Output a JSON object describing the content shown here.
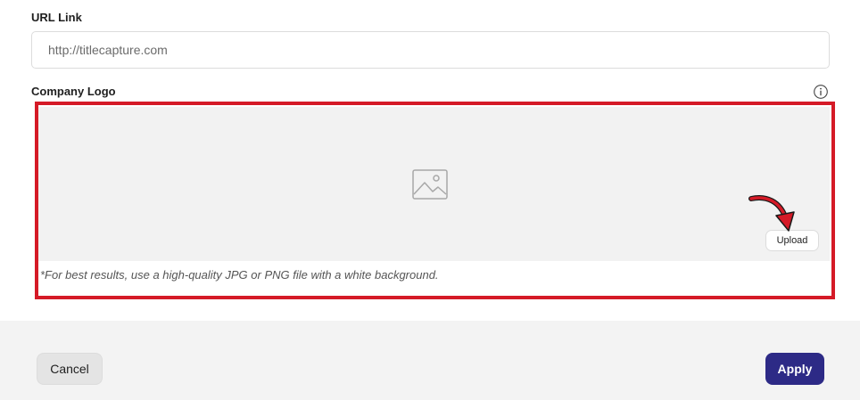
{
  "url_field": {
    "label": "URL Link",
    "value": "http://titlecapture.com"
  },
  "company_logo": {
    "label": "Company Logo",
    "info_icon": "info-circle-icon",
    "placeholder_icon": "image-placeholder-icon",
    "upload_label": "Upload",
    "hint": "*For best results, use a high-quality JPG or PNG file with a white background."
  },
  "annotation": {
    "highlight_color": "#d51a27",
    "arrow_icon": "curved-arrow-icon"
  },
  "footer": {
    "cancel_label": "Cancel",
    "apply_label": "Apply",
    "apply_color": "#2d2a86"
  }
}
